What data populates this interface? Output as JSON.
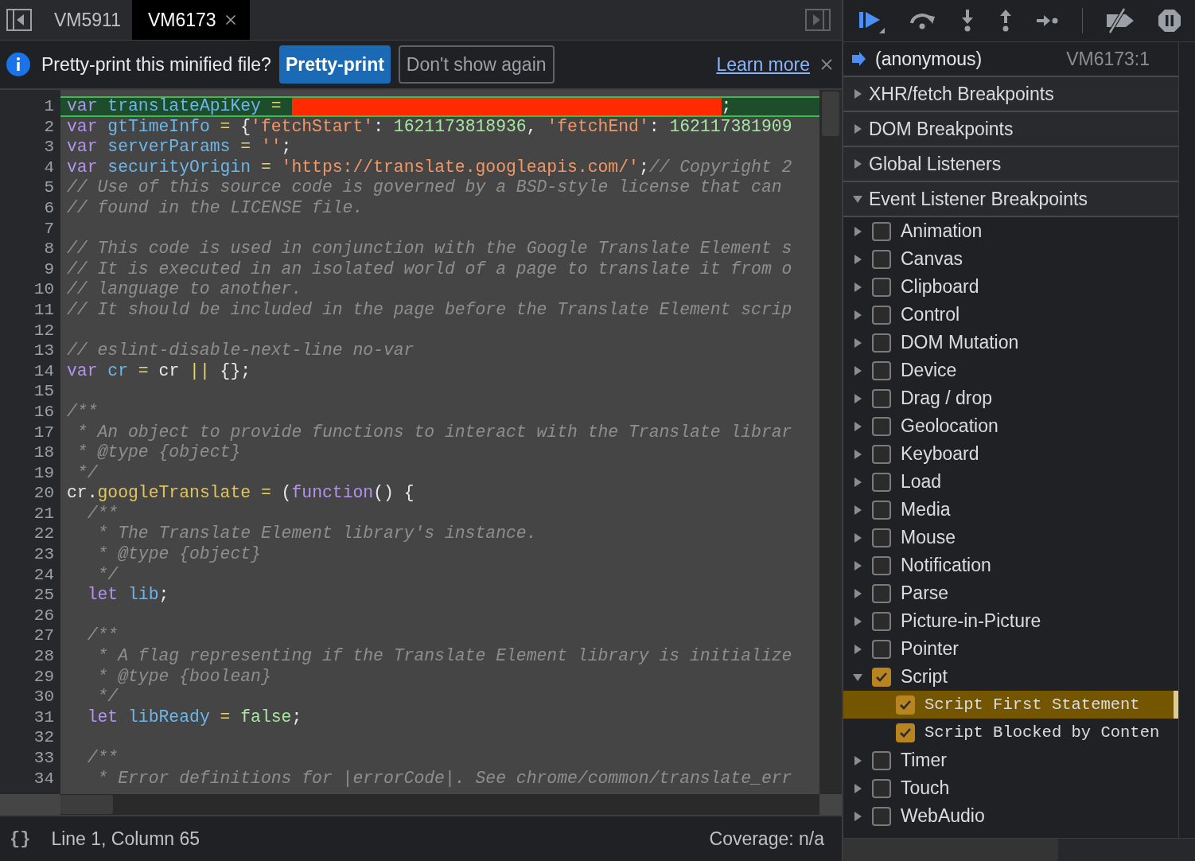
{
  "tabs": [
    {
      "label": "VM5911",
      "selected": false,
      "closable": false
    },
    {
      "label": "VM6173",
      "selected": true,
      "closable": true
    }
  ],
  "infobar": {
    "message": "Pretty-print this minified file?",
    "primary_button": "Pretty-print",
    "secondary_button": "Don't show again",
    "link": "Learn more"
  },
  "editor": {
    "lines": [
      {
        "number": "1",
        "highlighted": true,
        "tokens": [
          {
            "kind": "kw",
            "text": "var"
          },
          {
            "kind": "def",
            "text": " translateApiKey"
          },
          {
            "kind": "op",
            "text": " ="
          },
          {
            "kind": "redacted"
          },
          {
            "kind": "plain",
            "text": ";"
          }
        ]
      },
      {
        "number": "2",
        "highlighted": false,
        "tokens": [
          {
            "kind": "kw",
            "text": "var"
          },
          {
            "kind": "def",
            "text": " gtTimeInfo"
          },
          {
            "kind": "op",
            "text": " ="
          },
          {
            "kind": "plain",
            "text": " {"
          },
          {
            "kind": "str",
            "text": "'fetchStart'"
          },
          {
            "kind": "plain",
            "text": ":"
          },
          {
            "kind": "num",
            "text": " 1621173818936"
          },
          {
            "kind": "plain",
            "text": ","
          },
          {
            "kind": "str",
            "text": " 'fetchEnd'"
          },
          {
            "kind": "plain",
            "text": ":"
          },
          {
            "kind": "num",
            "text": " 162117381909"
          }
        ]
      },
      {
        "number": "3",
        "highlighted": false,
        "tokens": [
          {
            "kind": "kw",
            "text": "var"
          },
          {
            "kind": "def",
            "text": " serverParams"
          },
          {
            "kind": "op",
            "text": " ="
          },
          {
            "kind": "str",
            "text": " ''"
          },
          {
            "kind": "plain",
            "text": ";"
          }
        ]
      },
      {
        "number": "4",
        "highlighted": false,
        "tokens": [
          {
            "kind": "kw",
            "text": "var"
          },
          {
            "kind": "def",
            "text": " securityOrigin"
          },
          {
            "kind": "op",
            "text": " ="
          },
          {
            "kind": "str",
            "text": " 'https://translate.googleapis.com/'"
          },
          {
            "kind": "plain",
            "text": ";"
          },
          {
            "kind": "com",
            "text": "// Copyright 2"
          }
        ]
      },
      {
        "number": "5",
        "highlighted": false,
        "tokens": [
          {
            "kind": "com",
            "text": "// Use of this source code is governed by a BSD-style license that can"
          }
        ]
      },
      {
        "number": "6",
        "highlighted": false,
        "tokens": [
          {
            "kind": "com",
            "text": "// found in the LICENSE file."
          }
        ]
      },
      {
        "number": "7",
        "highlighted": false
      },
      {
        "number": "8",
        "highlighted": false,
        "tokens": [
          {
            "kind": "com",
            "text": "// This code is used in conjunction with the Google Translate Element s"
          }
        ]
      },
      {
        "number": "9",
        "highlighted": false,
        "tokens": [
          {
            "kind": "com",
            "text": "// It is executed in an isolated world of a page to translate it from o"
          }
        ]
      },
      {
        "number": "10",
        "highlighted": false,
        "tokens": [
          {
            "kind": "com",
            "text": "// language to another."
          }
        ]
      },
      {
        "number": "11",
        "highlighted": false,
        "tokens": [
          {
            "kind": "com",
            "text": "// It should be included in the page before the Translate Element scrip"
          }
        ]
      },
      {
        "number": "12",
        "highlighted": false
      },
      {
        "number": "13",
        "highlighted": false,
        "tokens": [
          {
            "kind": "com",
            "text": "// eslint-disable-next-line no-var"
          }
        ]
      },
      {
        "number": "14",
        "highlighted": false,
        "tokens": [
          {
            "kind": "kw",
            "text": "var"
          },
          {
            "kind": "def",
            "text": " cr"
          },
          {
            "kind": "op",
            "text": " ="
          },
          {
            "kind": "plain",
            "text": " cr"
          },
          {
            "kind": "op",
            "text": " ||"
          },
          {
            "kind": "plain",
            "text": " {};"
          }
        ]
      },
      {
        "number": "15",
        "highlighted": false
      },
      {
        "number": "16",
        "highlighted": false,
        "tokens": [
          {
            "kind": "com",
            "text": "/**"
          }
        ]
      },
      {
        "number": "17",
        "highlighted": false,
        "tokens": [
          {
            "kind": "com",
            "text": " * An object to provide functions to interact with the Translate librar"
          }
        ]
      },
      {
        "number": "18",
        "highlighted": false,
        "tokens": [
          {
            "kind": "com",
            "text": " * @type {object}"
          }
        ]
      },
      {
        "number": "19",
        "highlighted": false,
        "tokens": [
          {
            "kind": "com",
            "text": " */"
          }
        ]
      },
      {
        "number": "20",
        "highlighted": false,
        "tokens": [
          {
            "kind": "plain",
            "text": "cr."
          },
          {
            "kind": "prop",
            "text": "googleTranslate"
          },
          {
            "kind": "op",
            "text": " ="
          },
          {
            "kind": "plain",
            "text": " ("
          },
          {
            "kind": "kw",
            "text": "function"
          },
          {
            "kind": "plain",
            "text": "() {"
          }
        ]
      },
      {
        "number": "21",
        "highlighted": false,
        "tokens": [
          {
            "kind": "com",
            "text": "  /**"
          }
        ]
      },
      {
        "number": "22",
        "highlighted": false,
        "tokens": [
          {
            "kind": "com",
            "text": "   * The Translate Element library's instance."
          }
        ]
      },
      {
        "number": "23",
        "highlighted": false,
        "tokens": [
          {
            "kind": "com",
            "text": "   * @type {object}"
          }
        ]
      },
      {
        "number": "24",
        "highlighted": false,
        "tokens": [
          {
            "kind": "com",
            "text": "   */"
          }
        ]
      },
      {
        "number": "25",
        "highlighted": false,
        "tokens": [
          {
            "kind": "kw",
            "text": "  let"
          },
          {
            "kind": "def",
            "text": " lib"
          },
          {
            "kind": "plain",
            "text": ";"
          }
        ]
      },
      {
        "number": "26",
        "highlighted": false
      },
      {
        "number": "27",
        "highlighted": false,
        "tokens": [
          {
            "kind": "com",
            "text": "  /**"
          }
        ]
      },
      {
        "number": "28",
        "highlighted": false,
        "tokens": [
          {
            "kind": "com",
            "text": "   * A flag representing if the Translate Element library is initialize"
          }
        ]
      },
      {
        "number": "29",
        "highlighted": false,
        "tokens": [
          {
            "kind": "com",
            "text": "   * @type {boolean}"
          }
        ]
      },
      {
        "number": "30",
        "highlighted": false,
        "tokens": [
          {
            "kind": "com",
            "text": "   */"
          }
        ]
      },
      {
        "number": "31",
        "highlighted": false,
        "tokens": [
          {
            "kind": "kw",
            "text": "  let"
          },
          {
            "kind": "def",
            "text": " libReady"
          },
          {
            "kind": "op",
            "text": " ="
          },
          {
            "kind": "num",
            "text": " false"
          },
          {
            "kind": "plain",
            "text": ";"
          }
        ]
      },
      {
        "number": "32",
        "highlighted": false
      },
      {
        "number": "33",
        "highlighted": false,
        "tokens": [
          {
            "kind": "com",
            "text": "  /**"
          }
        ]
      },
      {
        "number": "34",
        "highlighted": false,
        "tokens": [
          {
            "kind": "com",
            "text": "   * Error definitions for |errorCode|. See chrome/common/translate_err"
          }
        ]
      }
    ]
  },
  "status_bar": {
    "format_icon": "{}",
    "position": "Line 1, Column 65",
    "coverage": "Coverage: n/a"
  },
  "call_stack": [
    {
      "function": "(anonymous)",
      "location": "VM6173:1",
      "selected": true
    }
  ],
  "sections": [
    {
      "title": "XHR/fetch Breakpoints",
      "expanded": false
    },
    {
      "title": "DOM Breakpoints",
      "expanded": false
    },
    {
      "title": "Global Listeners",
      "expanded": false
    },
    {
      "title": "Event Listener Breakpoints",
      "expanded": true,
      "categories": [
        {
          "label": "Animation",
          "checked": false,
          "expanded": false
        },
        {
          "label": "Canvas",
          "checked": false,
          "expanded": false
        },
        {
          "label": "Clipboard",
          "checked": false,
          "expanded": false
        },
        {
          "label": "Control",
          "checked": false,
          "expanded": false
        },
        {
          "label": "DOM Mutation",
          "checked": false,
          "expanded": false
        },
        {
          "label": "Device",
          "checked": false,
          "expanded": false
        },
        {
          "label": "Drag / drop",
          "checked": false,
          "expanded": false
        },
        {
          "label": "Geolocation",
          "checked": false,
          "expanded": false
        },
        {
          "label": "Keyboard",
          "checked": false,
          "expanded": false
        },
        {
          "label": "Load",
          "checked": false,
          "expanded": false
        },
        {
          "label": "Media",
          "checked": false,
          "expanded": false
        },
        {
          "label": "Mouse",
          "checked": false,
          "expanded": false
        },
        {
          "label": "Notification",
          "checked": false,
          "expanded": false
        },
        {
          "label": "Parse",
          "checked": false,
          "expanded": false
        },
        {
          "label": "Picture-in-Picture",
          "checked": false,
          "expanded": false
        },
        {
          "label": "Pointer",
          "checked": false,
          "expanded": false
        },
        {
          "label": "Script",
          "checked": true,
          "expanded": true,
          "children": [
            {
              "label": "Script First Statement",
              "checked": true,
              "selected": true
            },
            {
              "label": "Script Blocked by Conten",
              "checked": true,
              "selected": false
            }
          ]
        },
        {
          "label": "Timer",
          "checked": false,
          "expanded": false
        },
        {
          "label": "Touch",
          "checked": false,
          "expanded": false
        },
        {
          "label": "WebAudio",
          "checked": false,
          "expanded": false
        }
      ]
    }
  ]
}
